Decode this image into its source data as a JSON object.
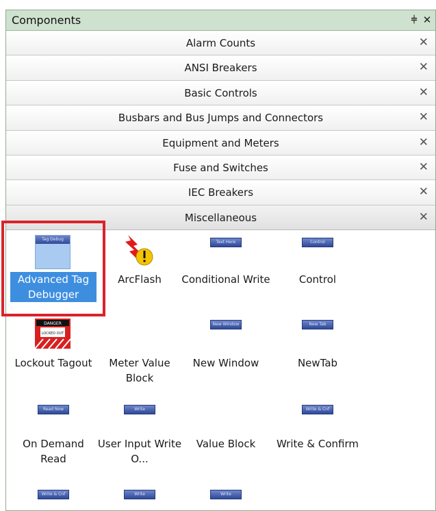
{
  "panel": {
    "title": "Components",
    "pin_glyph": "⫩",
    "close_glyph": "✕"
  },
  "groups": [
    {
      "label": "Alarm Counts",
      "close": "✕"
    },
    {
      "label": "ANSI Breakers",
      "close": "✕"
    },
    {
      "label": "Basic Controls",
      "close": "✕"
    },
    {
      "label": "Busbars and Bus Jumps and Connectors",
      "close": "✕"
    },
    {
      "label": "Equipment and Meters",
      "close": "✕"
    },
    {
      "label": "Fuse and Switches",
      "close": "✕"
    },
    {
      "label": "IEC Breakers",
      "close": "✕"
    },
    {
      "label": "Miscellaneous",
      "close": "✕"
    }
  ],
  "items": [
    {
      "label": "Advanced Tag Debugger",
      "thumb": "Tag Debug",
      "selected": true
    },
    {
      "label": "ArcFlash",
      "icon": "arcflash-icon"
    },
    {
      "label": "Conditional Write",
      "thumb": "Text Here"
    },
    {
      "label": "Control",
      "thumb": "Control"
    },
    {
      "label": "Lockout Tagout",
      "icon": "lockout-tagout-icon",
      "sign_top": "DANGER",
      "sign_mid": "LOCKED OUT"
    },
    {
      "label": "Meter Value Block",
      "thumb": ""
    },
    {
      "label": "New Window",
      "thumb": "New Window"
    },
    {
      "label": "NewTab",
      "thumb": "New Tab"
    },
    {
      "label": "On Demand Read",
      "thumb": "Read Now"
    },
    {
      "label": "User Input Write O...",
      "thumb": "Write"
    },
    {
      "label": "Value Block",
      "thumb": ""
    },
    {
      "label": "Write & Confirm",
      "thumb": "Write & Cnf"
    },
    {
      "label": "",
      "thumb": "Write & Cnf"
    },
    {
      "label": "",
      "thumb": "Write"
    },
    {
      "label": "",
      "thumb": "Write"
    }
  ],
  "colors": {
    "selection": "#3e8ee0",
    "highlight_box": "#d9232b",
    "titlebar": "#cfe1cf"
  }
}
